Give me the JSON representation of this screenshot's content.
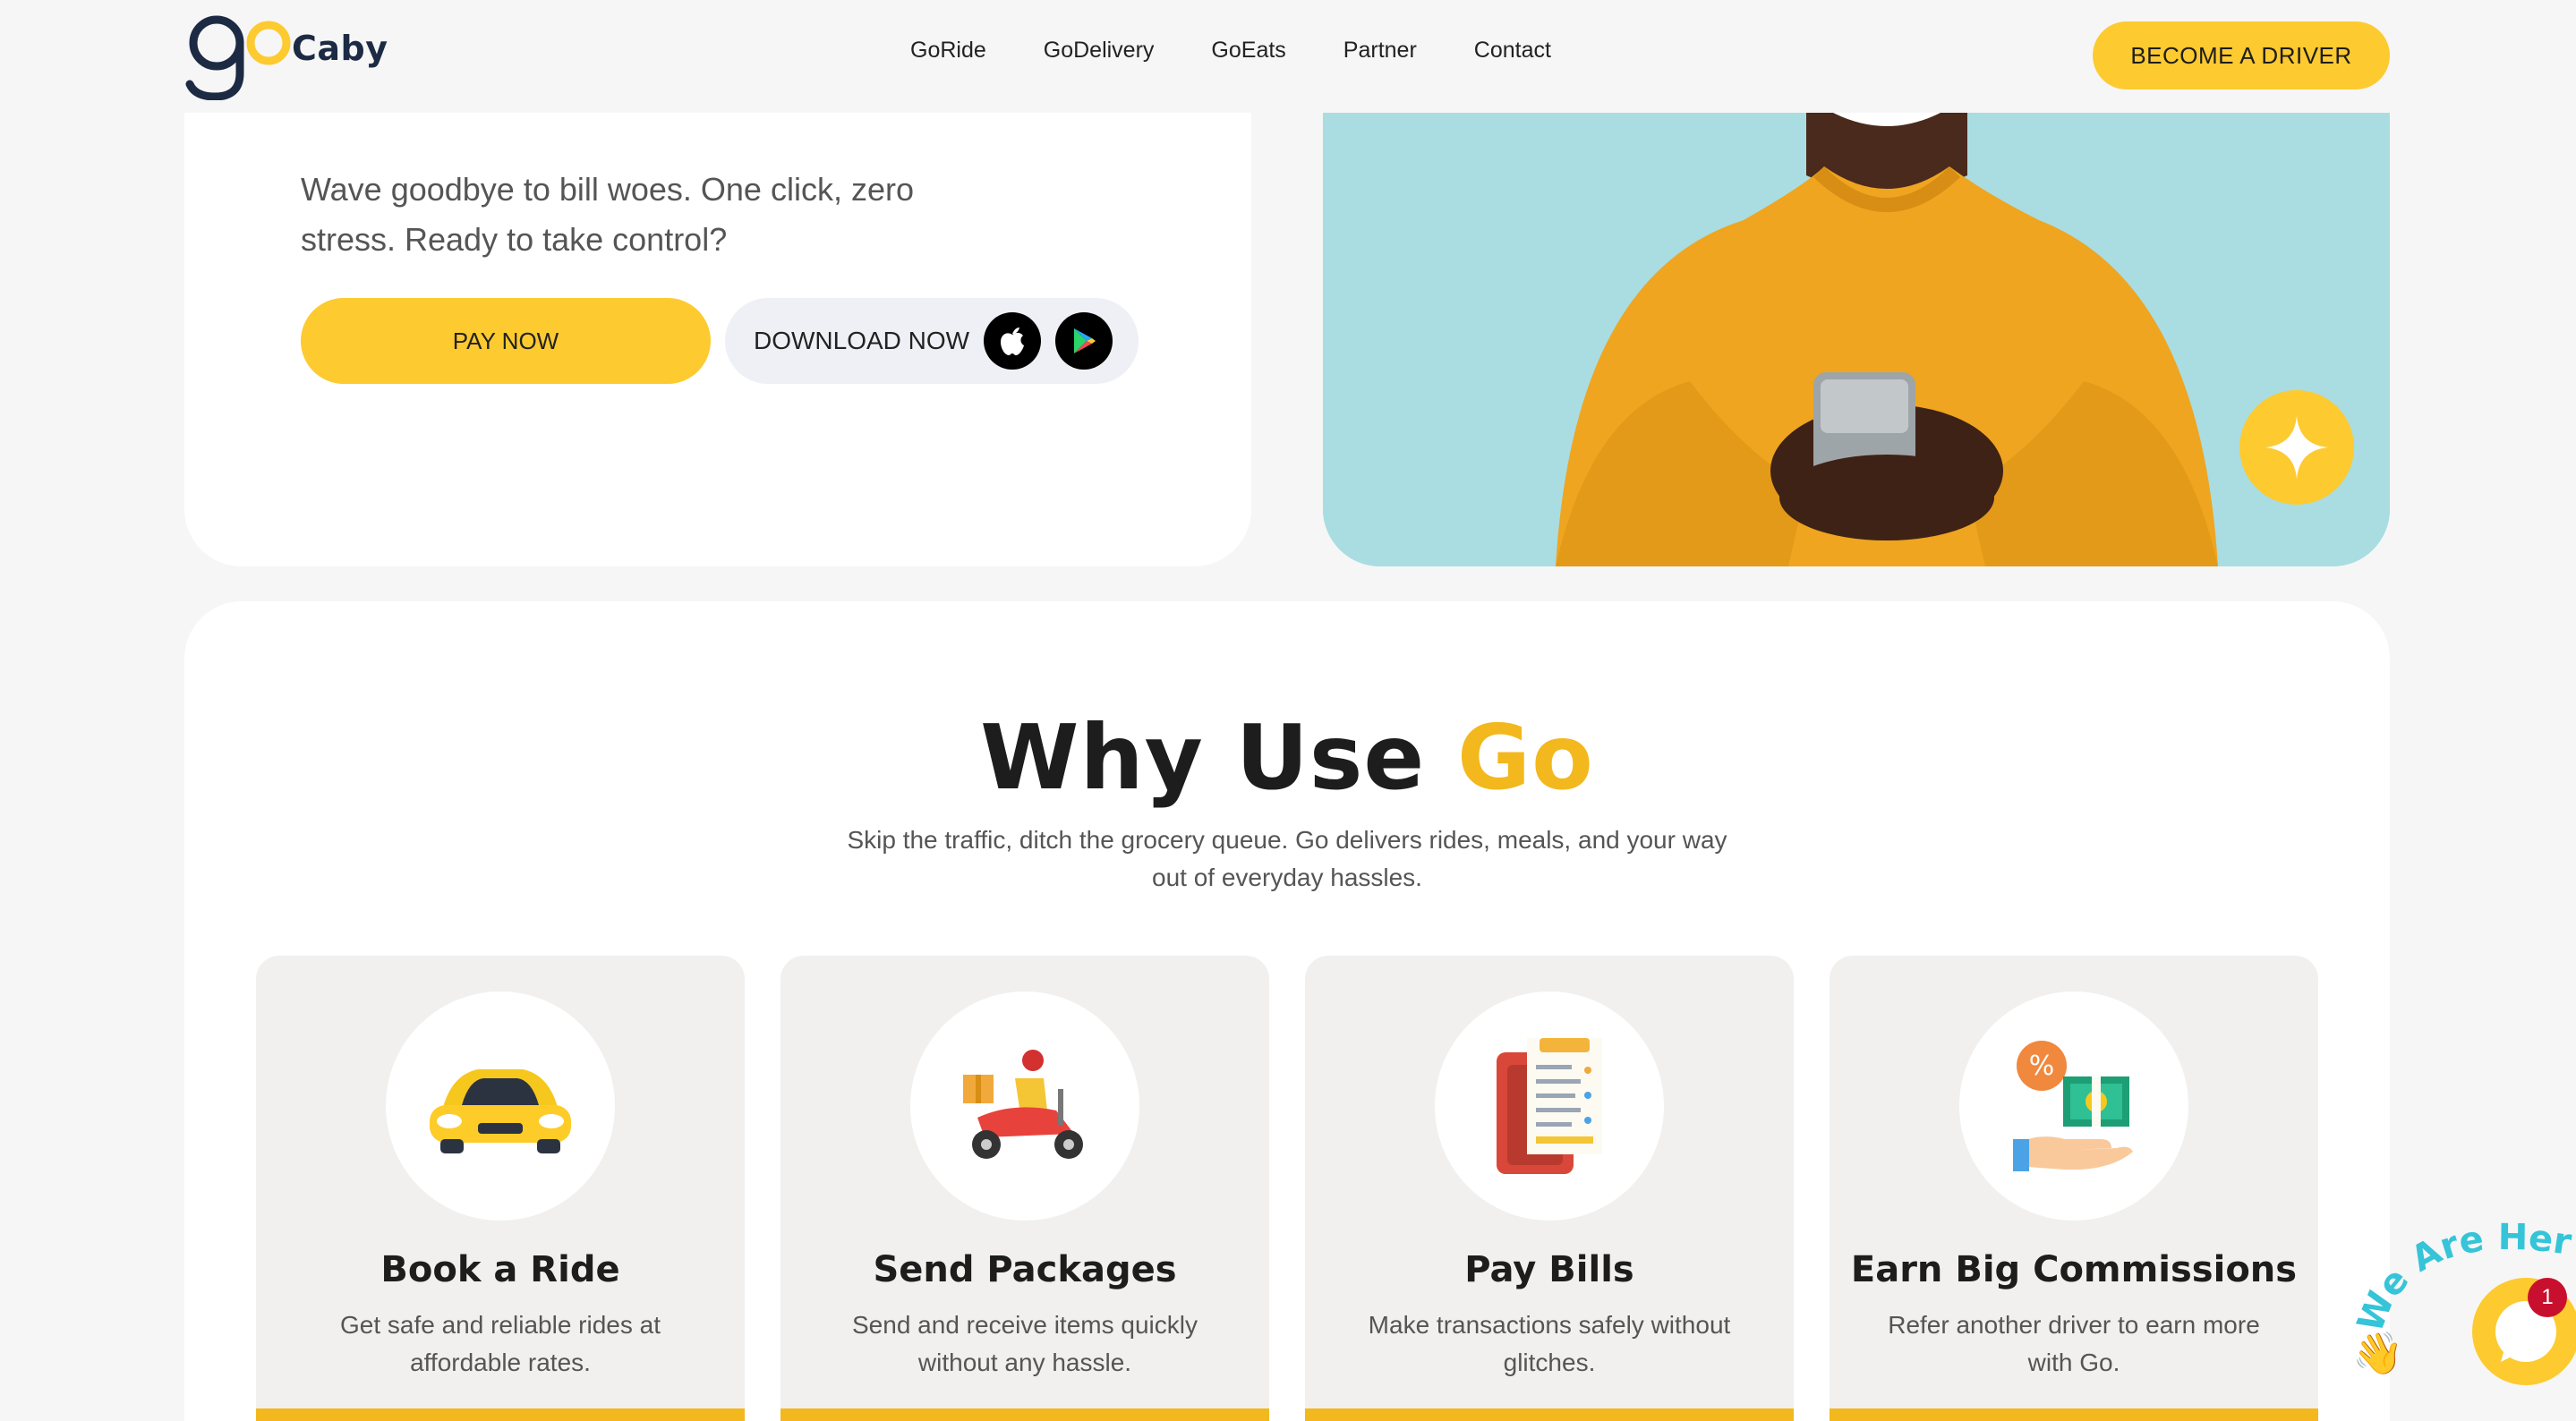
{
  "brand": {
    "logo_text": "Caby"
  },
  "nav": {
    "links": [
      "GoRide",
      "GoDelivery",
      "GoEats",
      "Partner",
      "Contact"
    ],
    "cta": "BECOME A DRIVER"
  },
  "hero": {
    "text": "Wave goodbye to bill woes. One click, zero stress. Ready to take control?",
    "pay_button": "PAY NOW",
    "download_label": "DOWNLOAD NOW"
  },
  "why": {
    "title_main": "Why Use ",
    "title_accent": "Go",
    "subtitle": "Skip the traffic, ditch the grocery queue. Go delivers rides, meals, and your way out of everyday hassles.",
    "cards": [
      {
        "title": "Book a Ride",
        "desc": "Get safe and reliable rides at affordable rates.",
        "icon": "car-icon"
      },
      {
        "title": "Send Packages",
        "desc": "Send and receive items quickly without any hassle.",
        "icon": "delivery-scooter-icon"
      },
      {
        "title": "Pay Bills",
        "desc": "Make transactions safely without glitches.",
        "icon": "bill-receipt-icon"
      },
      {
        "title": "Earn Big Commissions",
        "desc": "Refer another driver to earn more with Go.",
        "icon": "money-hand-icon"
      }
    ]
  },
  "chat": {
    "label": "We Are Here!",
    "badge": "1"
  },
  "colors": {
    "accent": "#fdca30",
    "accent_text": "#f2b81d",
    "navy": "#1d2a44"
  }
}
